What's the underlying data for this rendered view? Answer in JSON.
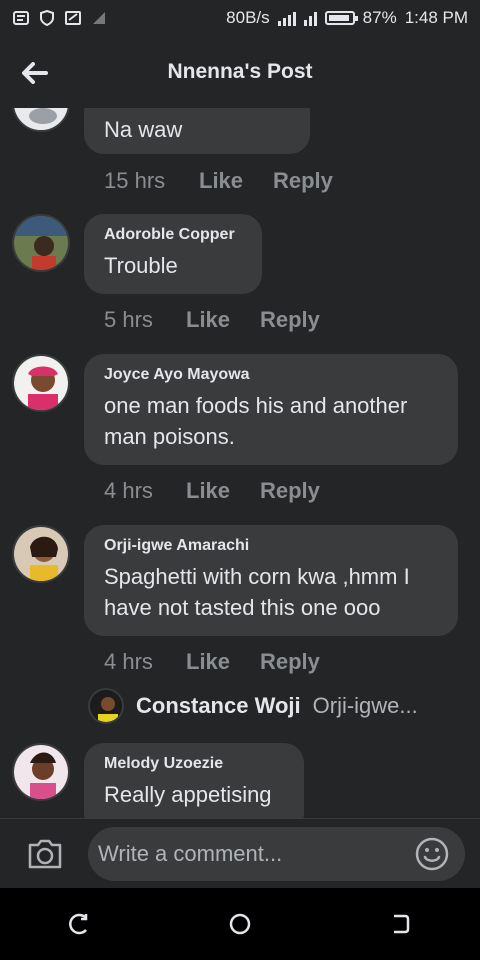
{
  "status_bar": {
    "speed": "80B/s",
    "battery": "87%",
    "time": "1:48 PM"
  },
  "header": {
    "title": "Nnenna's Post"
  },
  "comments": [
    {
      "author": "",
      "text": "Na waw",
      "time": "15 hrs",
      "like": "Like",
      "reply": "Reply"
    },
    {
      "author": "Adoroble Copper",
      "text": "Trouble",
      "time": "5 hrs",
      "like": "Like",
      "reply": "Reply"
    },
    {
      "author": "Joyce Ayo Mayowa",
      "text": "one man foods his and another man poisons.",
      "time": "4 hrs",
      "like": "Like",
      "reply": "Reply"
    },
    {
      "author": "Orji-igwe Amarachi",
      "text": "Spaghetti with corn kwa ,hmm I have not tasted this one ooo",
      "time": "4 hrs",
      "like": "Like",
      "reply": "Reply"
    },
    {
      "author": "Melody Uzoezie",
      "text": "Really appetising"
    }
  ],
  "reply_preview": {
    "name": "Constance Woji",
    "snippet": "Orji-igwe..."
  },
  "composer": {
    "placeholder": "Write a comment..."
  },
  "colors": {
    "background": "#242526",
    "bubble": "#3a3b3c",
    "text": "#e4e6eb",
    "muted": "#8a8d91"
  },
  "icons": {
    "back": "arrow-left-icon",
    "camera": "camera-icon",
    "emoji": "emoji-icon",
    "nav_recent": "recent-apps-icon",
    "nav_home": "home-icon",
    "nav_back": "nav-back-icon"
  }
}
